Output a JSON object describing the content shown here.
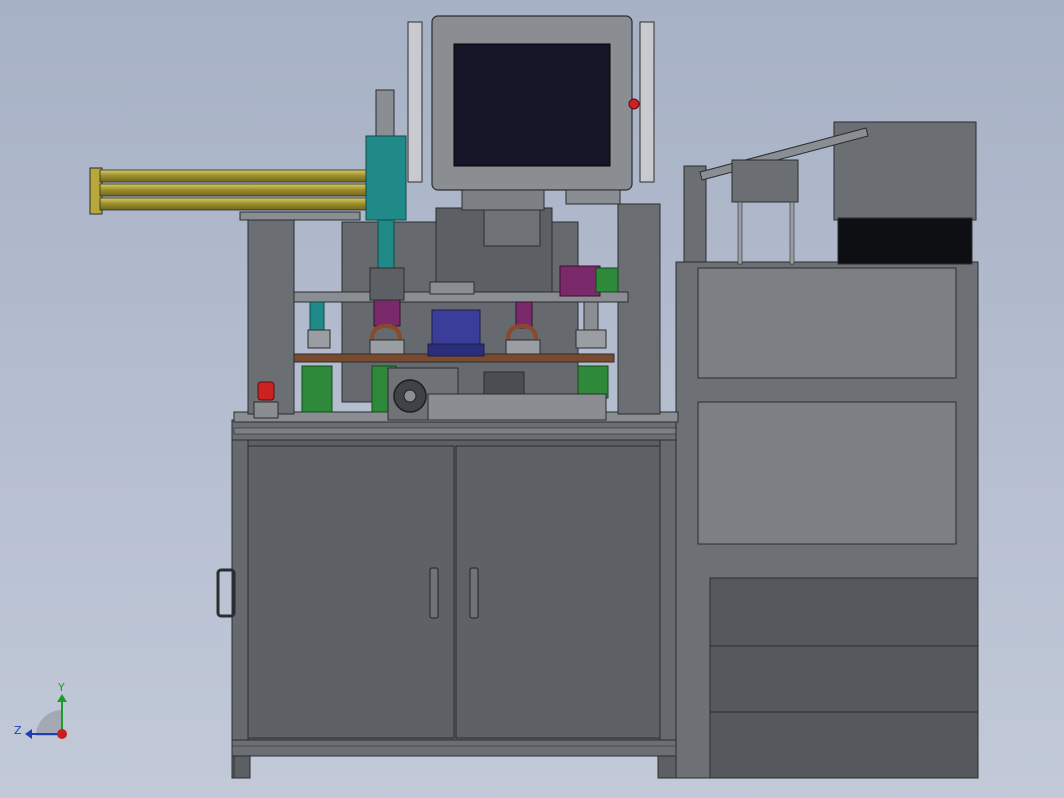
{
  "viewport": {
    "background_top": "#a7b1c5",
    "background_bottom": "#c2cad9"
  },
  "orientation_triad": {
    "y_label": "Y",
    "z_label": "Z",
    "y_color": "#1f9b2d",
    "z_color": "#1e3fb4",
    "origin_color": "#c81e1e"
  },
  "colors": {
    "steel": "#5c5f63",
    "steel_dark": "#3f4246",
    "steel_light": "#8a8d91",
    "frame_light": "#7c7f83",
    "screen": "#141628",
    "cylinder_yellow": "#b8a83a",
    "teal": "#1f8a88",
    "green": "#2e8a3a",
    "copper": "#8a4a2a",
    "blue": "#3a3e9a",
    "magenta": "#7a2a6a",
    "red": "#cc2222"
  }
}
